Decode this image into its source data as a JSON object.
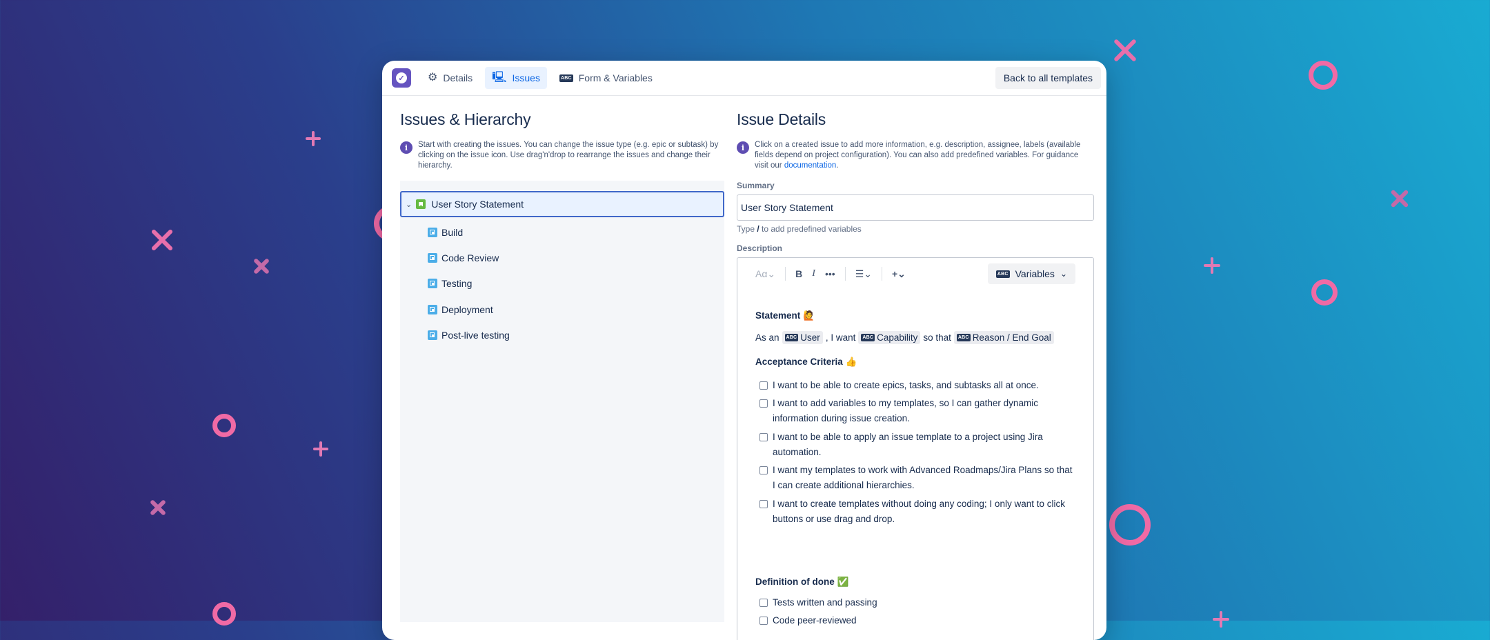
{
  "topbar": {
    "tabs": [
      {
        "label": "Details",
        "icon": "gear-icon"
      },
      {
        "label": "Issues",
        "icon": "issues-icon"
      },
      {
        "label": "Form & Variables",
        "icon": "variable-abc-icon"
      }
    ],
    "back_label": "Back to all templates"
  },
  "left": {
    "title": "Issues & Hierarchy",
    "info": "Start with creating the issues. You can change the issue type (e.g. epic or subtask) by clicking on the issue icon. Use drag'n'drop to rearrange the issues and change their hierarchy.",
    "root_issue": "User Story Statement",
    "sub_issues": [
      "Build",
      "Code Review",
      "Testing",
      "Deployment",
      "Post-live testing"
    ]
  },
  "right": {
    "title": "Issue Details",
    "info_text": "Click on a created issue to add more information, e.g. description, assignee, labels (available fields depend on project configuration). You can also add predefined variables. For guidance visit our ",
    "info_link": "documentation",
    "info_end": ".",
    "summary_label": "Summary",
    "summary_value": "User Story Statement",
    "hint_pre": "Type ",
    "hint_key": "/",
    "hint_post": " to add predefined variables",
    "description_label": "Description",
    "variables_label": "Variables",
    "abc_badge": "ABC",
    "statement_heading": "Statement 🙋",
    "as_an": "As an",
    "var_user": "User",
    "i_want": ", I want",
    "var_capability": "Capability",
    "so_that": "so that",
    "var_reason": "Reason / End Goal",
    "acceptance_heading": "Acceptance Criteria 👍",
    "criteria": [
      "I want to be able to create epics, tasks, and subtasks all at once.",
      "I want to add variables to my templates, so I can gather dynamic information during issue creation.",
      "I want to be able to apply an issue template to a project using Jira automation.",
      "I want my templates to work with Advanced Roadmaps/Jira Plans so that I can create additional hierarchies.",
      "I want to create templates without doing any coding; I only want to click buttons or use drag and drop."
    ],
    "dod_heading": "Definition of done ✅",
    "dod": [
      "Tests written and passing",
      "Code peer-reviewed"
    ]
  },
  "colors": {
    "accent": "#0c66e4",
    "logo": "#6554c0",
    "decor_pink": "#f06aa5"
  }
}
